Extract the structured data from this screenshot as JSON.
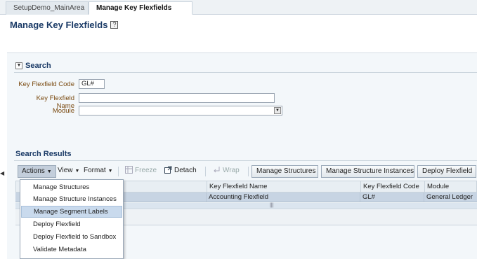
{
  "tabs": [
    {
      "label": "SetupDemo_MainArea"
    },
    {
      "label": "Manage Key Flexfields"
    }
  ],
  "page": {
    "title": "Manage Key Flexfields"
  },
  "search": {
    "title": "Search",
    "fields": {
      "code": {
        "label": "Key Flexfield Code",
        "value": "GL#"
      },
      "name": {
        "label": "Key Flexfield Name",
        "value": ""
      },
      "module": {
        "label": "Module",
        "value": ""
      }
    }
  },
  "results": {
    "title": "Search Results",
    "toolbar": {
      "actions": "Actions",
      "view": "View",
      "format": "Format",
      "freeze": "Freeze",
      "detach": "Detach",
      "wrap": "Wrap",
      "manage_structures": "Manage Structures",
      "manage_structure_instances": "Manage Structure Instances",
      "deploy_flexfield": "Deploy Flexfield"
    },
    "columns": [
      "Key Flexfield Name",
      "Key Flexfield Code",
      "Module"
    ],
    "rows": [
      {
        "name": "Accounting Flexfield",
        "code": "GL#",
        "module": "General Ledger"
      }
    ]
  },
  "actions_menu": {
    "items": [
      "Manage Structures",
      "Manage Structure Instances",
      "Manage Segment Labels",
      "Deploy Flexfield",
      "Deploy Flexfield to Sandbox",
      "Validate Metadata"
    ],
    "highlighted": "Manage Segment Labels"
  },
  "colors": {
    "title": "#1a3a66",
    "label": "#7a4a10",
    "selected_row": "#c7d4e3",
    "menu_highlight": "#c9daed"
  }
}
